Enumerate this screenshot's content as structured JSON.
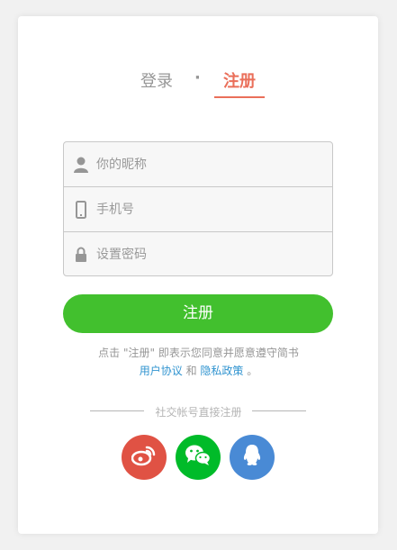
{
  "tabs": {
    "login_label": "登录",
    "separator": "·",
    "register_label": "注册"
  },
  "form": {
    "nickname_placeholder": "你的昵称",
    "phone_placeholder": "手机号",
    "password_placeholder": "设置密码"
  },
  "icons": {
    "nickname": "user-icon",
    "phone": "mobile-phone-icon",
    "password": "lock-icon",
    "weibo": "weibo-icon",
    "wechat": "wechat-icon",
    "qq": "qq-icon"
  },
  "submit_label": "注册",
  "agreement": {
    "prefix": "点击 \"注册\" 即表示您同意并愿意遵守简书",
    "user_agreement": "用户协议",
    "and": "和",
    "privacy_policy": "隐私政策",
    "suffix": "。"
  },
  "social": {
    "title": "社交帐号直接注册"
  },
  "colors": {
    "accent": "#ea6f5a",
    "button_green": "#42c02e",
    "link_blue": "#3194d0",
    "weibo": "#e05244",
    "wechat": "#00bb29",
    "qq": "#498ad5"
  }
}
